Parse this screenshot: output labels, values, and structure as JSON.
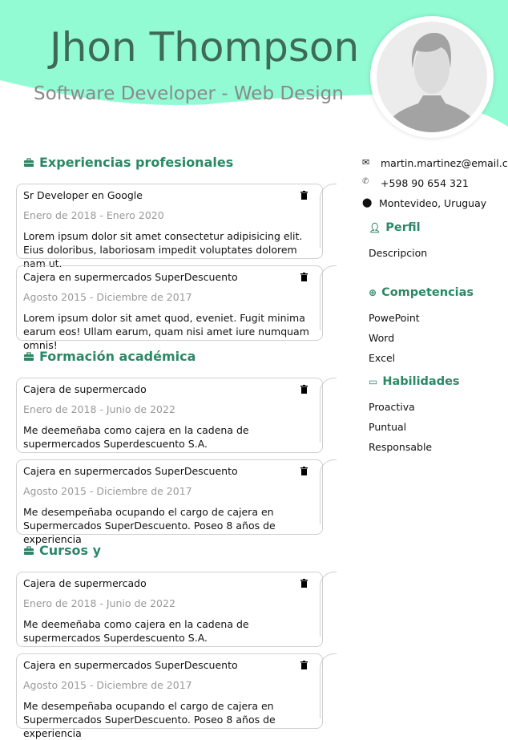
{
  "header": {
    "name": "Jhon Thompson",
    "subtitle": "Software Developer - Web Design",
    "accent_color": "#93fbd3",
    "avatar_icon": "user-silhouette"
  },
  "sections": [
    {
      "title": "Experiencias profesionales",
      "icon": "briefcase-icon",
      "items": [
        {
          "title": "Sr Developer en Google",
          "date": "Enero de 2018 - Enero 2020",
          "description": "Lorem ipsum dolor sit amet consectetur adipisicing elit. Eius doloribus, laboriosam impedit voluptates dolorem nam ut."
        },
        {
          "title": " Cajera en supermercados SuperDescuento",
          "date": "Agosto 2015 - Diciembre de 2017",
          "description": "Lorem ipsum dolor sit amet quod, eveniet. Fugit minima earum eos! Ullam earum, quam nisi amet iure numquam omnis!"
        }
      ]
    },
    {
      "title": "Formación académica",
      "icon": "briefcase-icon",
      "items": [
        {
          "title": "Cajera de supermercado",
          "date": "Enero de 2018 - Junio de 2022",
          "description": "Me deemeñaba como cajera en la cadena de supermercados Superdescuento S.A."
        },
        {
          "title": " Cajera en supermercados SuperDescuento",
          "date": "Agosto 2015 - Diciembre de 2017",
          "description": "Me desempeñaba ocupando el cargo de cajera en Supermercados SuperDescuento. Poseo 8 años de experiencia"
        }
      ]
    },
    {
      "title": "Cursos y",
      "icon": "briefcase-icon",
      "items": [
        {
          "title": "Cajera de supermercado",
          "date": "Enero de 2018 - Junio de 2022",
          "description": "Me deemeñaba como cajera en la cadena de supermercados Superdescuento S.A."
        },
        {
          "title": " Cajera en supermercados SuperDescuento",
          "date": "Agosto 2015 - Diciembre de 2017",
          "description": "Me desempeñaba ocupando el cargo de cajera en Supermercados SuperDescuento. Poseo 8 años de experiencia"
        }
      ]
    }
  ],
  "contact": {
    "email": "martin.martinez@email.c",
    "phone": "+598 90 654 321",
    "location": "Montevideo, Uruguay"
  },
  "perfil": {
    "title": "Perfil",
    "description": "Descripcion"
  },
  "competencias": {
    "title": "Competencias",
    "items": [
      "PowePoint",
      "Word",
      "Excel"
    ]
  },
  "habilidades": {
    "title": "Habilidades",
    "items": [
      "Proactiva",
      "Puntual",
      "Responsable"
    ]
  }
}
